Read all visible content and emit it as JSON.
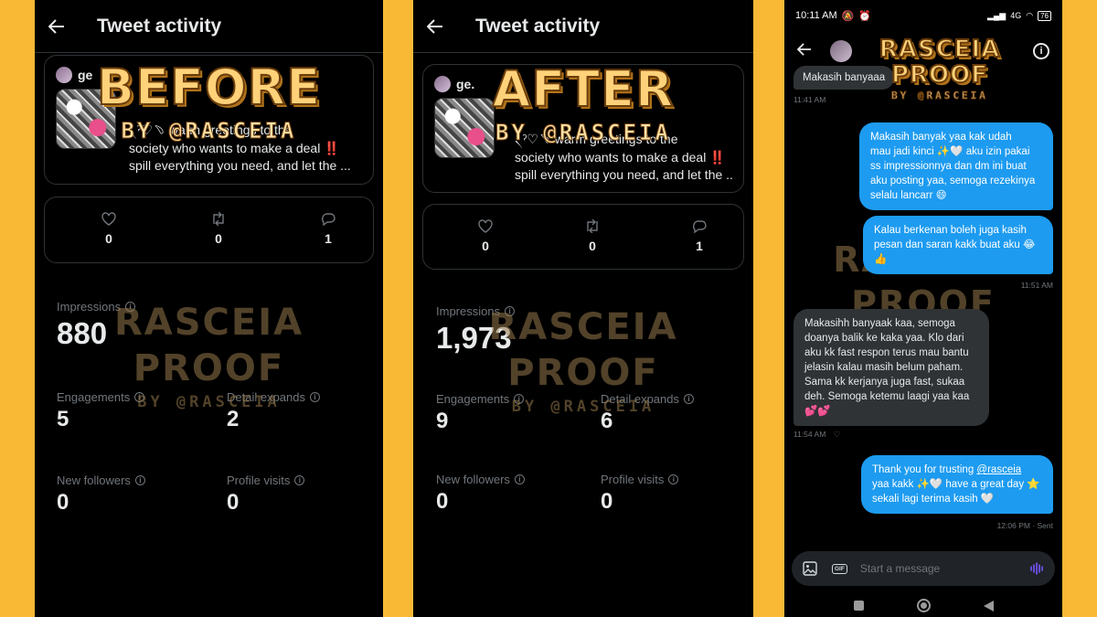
{
  "before": {
    "screen_title": "Tweet activity",
    "tweet": {
      "username": "ge",
      "text_lines": [
        "৲ˀ♡﹆ warm greetings to the",
        "society who wants to make a deal ‼️",
        "spill everything you need, and let the ..."
      ]
    },
    "engagement": {
      "likes": "0",
      "retweets": "0",
      "replies": "1"
    },
    "metrics": {
      "impressions_label": "Impressions",
      "impressions": "880",
      "engagements_label": "Engagements",
      "engagements": "5",
      "detail_expands_label": "Detail expands",
      "detail_expands": "2",
      "new_followers_label": "New followers",
      "new_followers": "0",
      "profile_visits_label": "Profile visits",
      "profile_visits": "0"
    },
    "watermark": {
      "title": "BEFORE",
      "by": "BY @RASCEIA",
      "faint_line1": "RASCEIA",
      "faint_line2": "PROOF",
      "faint_by": "BY @RASCEIA"
    }
  },
  "after": {
    "screen_title": "Tweet activity",
    "tweet": {
      "username": "ge.",
      "text_lines": [
        "৲ˀ♡﹆ warm greetings to the",
        "society who wants to make a deal ‼️",
        "spill everything you need, and let the ..."
      ]
    },
    "engagement": {
      "likes": "0",
      "retweets": "0",
      "replies": "1"
    },
    "metrics": {
      "impressions_label": "Impressions",
      "impressions": "1,973",
      "engagements_label": "Engagements",
      "engagements": "9",
      "detail_expands_label": "Detail expands",
      "detail_expands": "6",
      "new_followers_label": "New followers",
      "new_followers": "0",
      "profile_visits_label": "Profile visits",
      "profile_visits": "0"
    },
    "watermark": {
      "title": "AFTER",
      "by": "BY @RASCEIA",
      "faint_line1": "RASCEIA",
      "faint_line2": "PROOF",
      "faint_by": "BY @RASCEIA"
    }
  },
  "dm": {
    "status_time": "10:11 AM",
    "status_network": "4G",
    "battery": "76",
    "watermark": {
      "line1": "RASCEIA",
      "line2": "PROOF",
      "by": "BY @RASCEIA"
    },
    "messages": [
      {
        "side": "in",
        "lines": [
          "Makasih banyaaa"
        ],
        "time": "11:41 AM"
      },
      {
        "side": "out",
        "lines": [
          "Makasih banyak yaa kak udah",
          "mau jadi kinci ✨🤍 aku izin pakai",
          "ss impressionnya dan dm ini buat",
          "aku posting yaa, semoga rezekinya",
          "selalu lancarr 😄"
        ]
      },
      {
        "side": "out",
        "lines": [
          "Kalau berkenan boleh juga kasih",
          "pesan dan saran kakk buat aku 😂",
          "👍"
        ],
        "time": "11:51 AM"
      },
      {
        "side": "in",
        "lines": [
          "Makasihh banyaak kaa, semoga",
          "doanya balik ke kaka yaa. Klo dari",
          "aku kk fast respon terus mau bantu",
          "jelasin kalau masih belum paham.",
          "Sama kk kerjanya juga fast, sukaa",
          "deh. Semoga ketemu laagi yaa kaa",
          "💕💕"
        ],
        "time": "11:54 AM"
      },
      {
        "side": "out",
        "lines": [
          "Thank you for trusting ",
          "yaa kakk ✨🤍 have a great day ⭐",
          "sekali lagi terima kasih 🤍"
        ],
        "mention": "@rasceia",
        "time": "12:06 PM · Sent"
      }
    ],
    "composer_placeholder": "Start a message",
    "gif_label": "GIF"
  }
}
